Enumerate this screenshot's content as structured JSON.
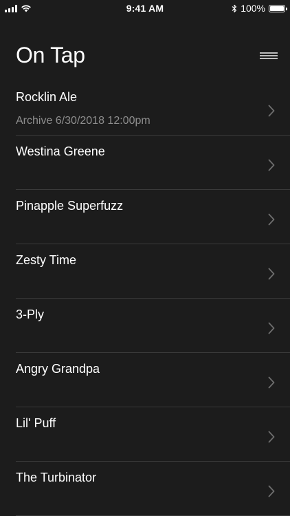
{
  "status_bar": {
    "time": "9:41 AM",
    "battery_percent": "100%",
    "battery_level": 1.0,
    "icons": [
      "signal-icon",
      "wifi-icon",
      "bluetooth-icon",
      "battery-icon"
    ]
  },
  "header": {
    "title": "On Tap",
    "menu_icon": "hamburger-menu-icon"
  },
  "list": {
    "items": [
      {
        "name": "Rocklin Ale",
        "subtitle": "Archive 6/30/2018 12:00pm"
      },
      {
        "name": "Westina Greene",
        "subtitle": ""
      },
      {
        "name": "Pinapple Superfuzz",
        "subtitle": ""
      },
      {
        "name": "Zesty Time",
        "subtitle": ""
      },
      {
        "name": "3-Ply",
        "subtitle": ""
      },
      {
        "name": "Angry Grandpa",
        "subtitle": ""
      },
      {
        "name": "Lil' Puff",
        "subtitle": ""
      },
      {
        "name": "The Turbinator",
        "subtitle": ""
      }
    ],
    "chevron_icon": "chevron-right-icon"
  },
  "colors": {
    "background": "#1c1c1c",
    "text_primary": "#ffffff",
    "text_secondary": "#8e8e8e",
    "separator": "#3a3a3a",
    "chevron": "#6e6e6e"
  }
}
